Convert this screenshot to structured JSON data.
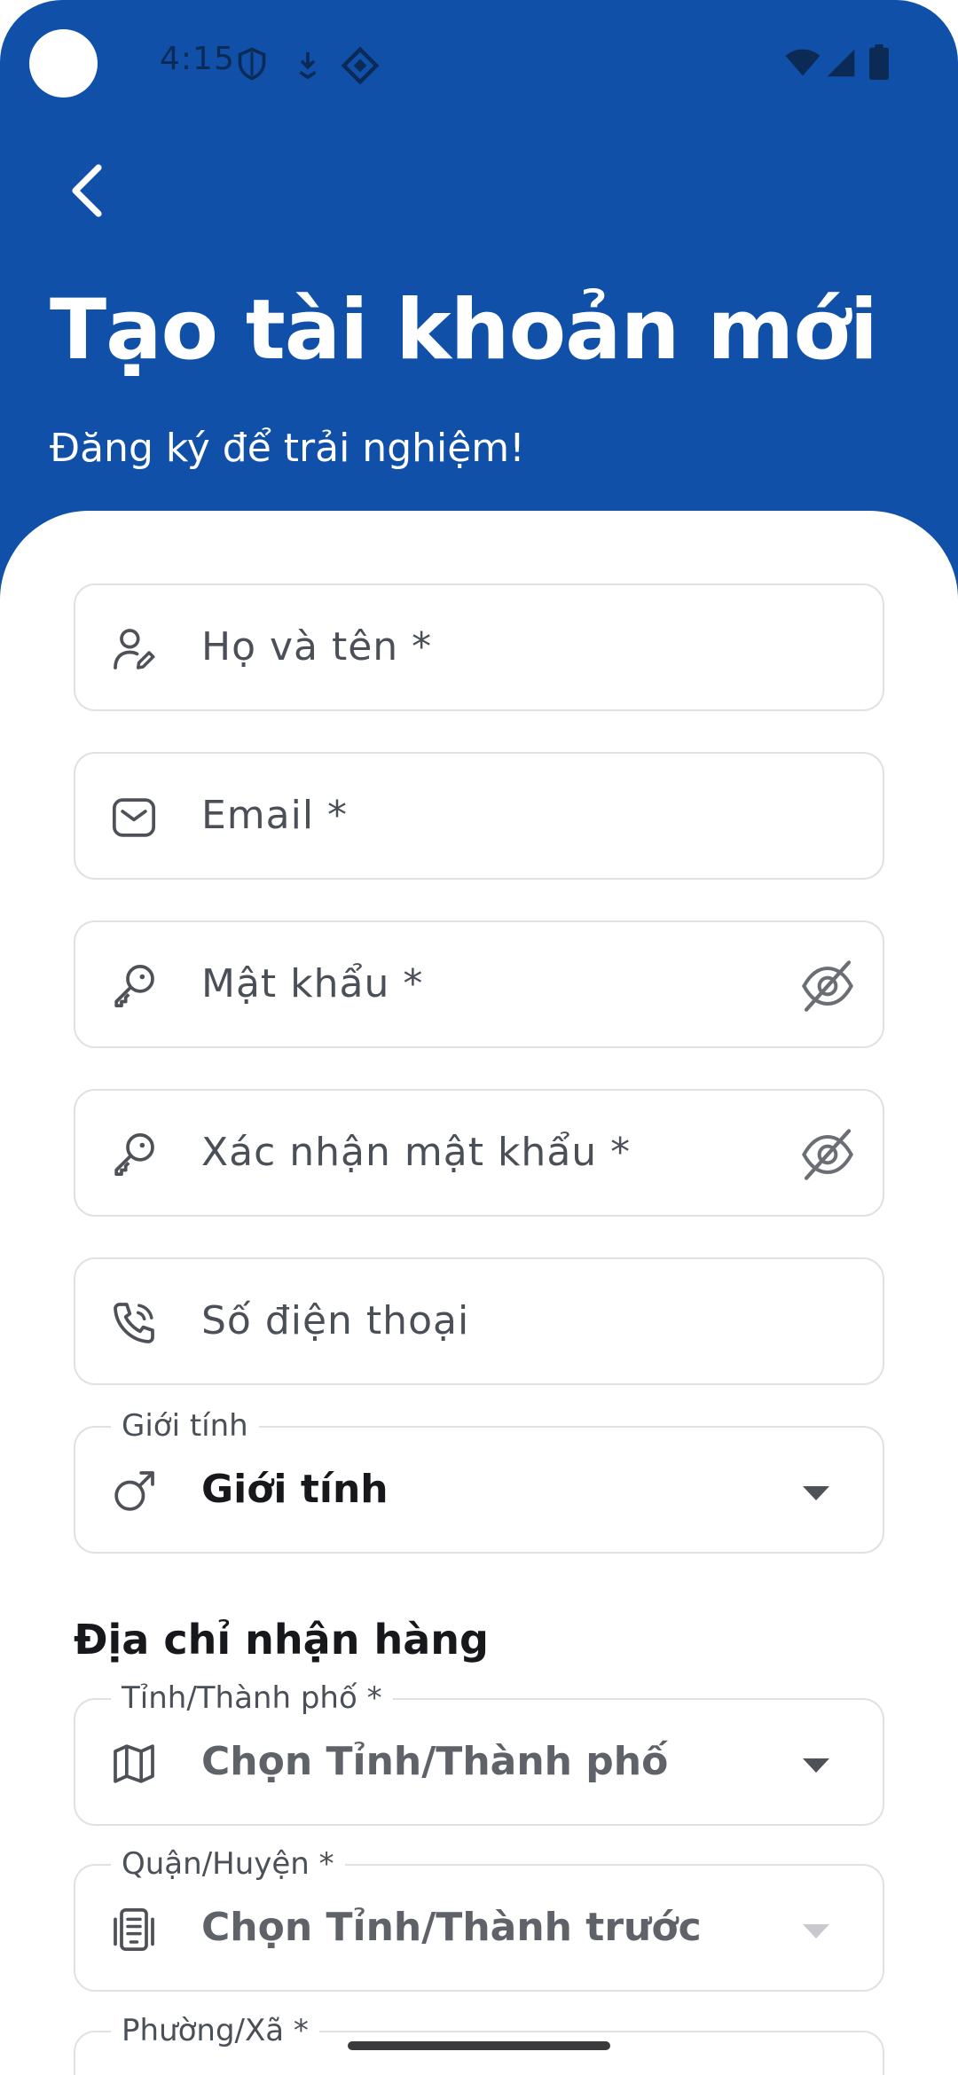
{
  "status_bar": {
    "time": "4:15"
  },
  "header": {
    "title": "Tạo tài khoản mới",
    "subtitle": "Đăng ký để trải nghiệm!",
    "background_color": "#1150A8"
  },
  "form": {
    "full_name": {
      "placeholder": "Họ và tên *",
      "icon": "user-edit-icon"
    },
    "email": {
      "placeholder": "Email *",
      "icon": "mail-icon"
    },
    "password": {
      "placeholder": "Mật khẩu *",
      "icon": "key-icon",
      "toggle_icon": "eye-off-icon"
    },
    "confirm_password": {
      "placeholder": "Xác nhận mật khẩu *",
      "icon": "key-icon",
      "toggle_icon": "eye-off-icon"
    },
    "phone": {
      "placeholder": "Số điện thoại",
      "icon": "phone-icon"
    },
    "gender": {
      "label": "Giới tính",
      "value": "Giới tính",
      "icon": "male-icon"
    }
  },
  "address": {
    "section_title": "Địa chỉ nhận hàng",
    "province": {
      "label": "Tỉnh/Thành phố *",
      "value": "Chọn Tỉnh/Thành phố",
      "icon": "map-icon"
    },
    "district": {
      "label": "Quận/Huyện *",
      "value": "Chọn Tỉnh/Thành trước",
      "icon": "building-icon"
    },
    "ward": {
      "label": "Phường/Xã *"
    }
  }
}
